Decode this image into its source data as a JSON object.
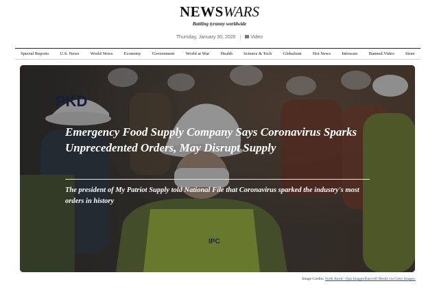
{
  "masthead": {
    "logo_news": "NEWS",
    "logo_wars": "WARS",
    "tagline": "Battling tyranny worldwide"
  },
  "dateline": {
    "date": "Thursday, January 30, 2020",
    "video_label": "Video"
  },
  "nav": {
    "items": [
      "Special Reports",
      "U.S. News",
      "World News",
      "Economy",
      "Government",
      "World at War",
      "Health",
      "Science & Tech",
      "Globalism",
      "Hot News",
      "Infowars",
      "Banned.Video",
      "Store"
    ]
  },
  "hero": {
    "headline": "Emergency Food Supply Company Says Coronavirus Sparks Unprecedented Orders, May Disrupt Supply",
    "dek": "The president of My Patriot Supply told National File that Coronavirus sparked the industry's most orders in history",
    "photo_text": {
      "helmet_badge": "PKD",
      "vest_badge": "IPC"
    }
  },
  "credit": {
    "label": "Image Credits:",
    "link_text": "Ferdi Awed / Opn Images/Barcroft Media via Getty Images."
  }
}
